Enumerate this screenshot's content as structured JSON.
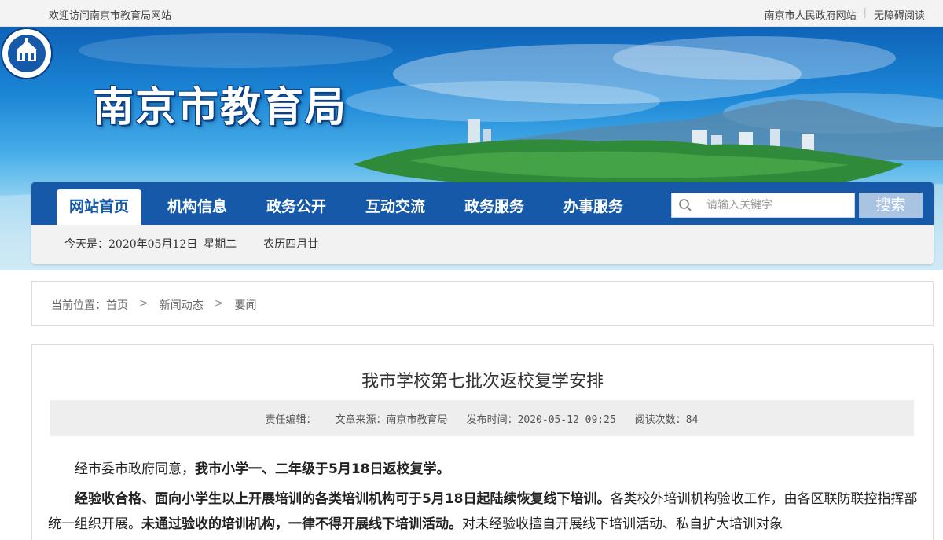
{
  "topbar": {
    "welcome": "欢迎访问南京市教育局网站",
    "gov_link": "南京市人民政府网站",
    "separator": "|",
    "accessibility_link": "无障碍阅读"
  },
  "header": {
    "site_name": "南京市教育局"
  },
  "nav": {
    "items": [
      {
        "label": "网站首页"
      },
      {
        "label": "机构信息"
      },
      {
        "label": "政务公开"
      },
      {
        "label": "互动交流"
      },
      {
        "label": "政务服务"
      },
      {
        "label": "办事服务"
      }
    ],
    "search_placeholder": "请输入关键字",
    "search_button": "搜索"
  },
  "dateline": {
    "today_label": "今天是：",
    "date": "2020年05月12日",
    "weekday": "星期二",
    "lunar": "农历四月廿"
  },
  "breadcrumb": {
    "prefix": "当前位置：",
    "items": [
      "首页",
      "新闻动态",
      "要闻"
    ],
    "separator": ">"
  },
  "article": {
    "title": "我市学校第七批次返校复学安排",
    "meta": {
      "editor": "责任编辑：",
      "source": "文章来源：南京市教育局",
      "publish_time": "发布时间：2020-05-12 09:25",
      "views": "阅读次数：84"
    },
    "p1_normal": "经市委市政府同意，",
    "p1_bold": "我市小学一、二年级于5月18日返校复学。",
    "p2_bold1": "经验收合格、面向小学生以上开展培训的各类培训机构可于5月18日起陆续恢复线下培训。",
    "p2_normal1": "各类校外培训机构验收工作，由各区联防联控指挥部统一组织开展。",
    "p2_bold2": "未通过验收的培训机构，一律不得开展线下培训活动。",
    "p2_normal2": "对未经验收擅自开展线下培训活动、私自扩大培训对象"
  },
  "colors": {
    "nav_bg": "#1559a8",
    "search_btn": "#a9c3e3",
    "meta_bg": "#eeeeee"
  },
  "icons": {
    "search": "magnifier-icon",
    "logo": "school-seal-icon"
  }
}
